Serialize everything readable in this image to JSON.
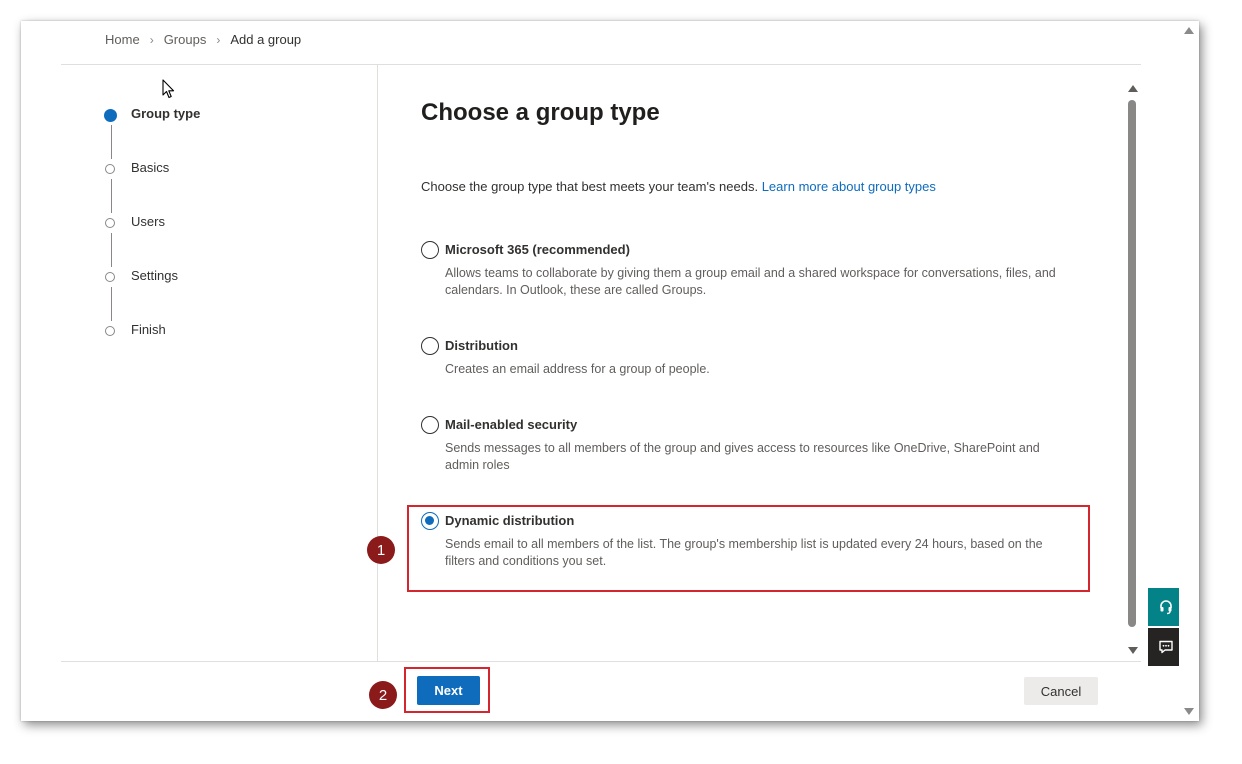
{
  "breadcrumb": {
    "items": [
      "Home",
      "Groups",
      "Add a group"
    ]
  },
  "steps": [
    {
      "label": "Group type",
      "active": true
    },
    {
      "label": "Basics",
      "active": false
    },
    {
      "label": "Users",
      "active": false
    },
    {
      "label": "Settings",
      "active": false
    },
    {
      "label": "Finish",
      "active": false
    }
  ],
  "main": {
    "title": "Choose a group type",
    "intro": "Choose the group type that best meets your team's needs.",
    "learn_more": "Learn more about group types",
    "options": [
      {
        "name": "Microsoft 365 (recommended)",
        "description": "Allows teams to collaborate by giving them a group email and a shared workspace for conversations, files, and calendars. In Outlook, these are called Groups.",
        "checked": false
      },
      {
        "name": "Distribution",
        "description": "Creates an email address for a group of people.",
        "checked": false
      },
      {
        "name": "Mail-enabled security",
        "description": "Sends messages to all members of the group and gives access to resources like OneDrive, SharePoint and admin roles",
        "checked": false
      },
      {
        "name": "Dynamic distribution",
        "description": "Sends email to all members of the list. The group's membership list is updated every 24 hours, based on the filters and conditions you set.",
        "checked": true
      }
    ]
  },
  "footer": {
    "next_label": "Next",
    "cancel_label": "Cancel"
  },
  "annotations": {
    "step1": "1",
    "step2": "2"
  },
  "icons": {
    "help": "headset-icon",
    "feedback": "feedback-icon",
    "cursor": "mouse-cursor-icon"
  },
  "colors": {
    "accent": "#0f6cbd",
    "highlight": "#d3262e",
    "badge": "#8b1a1a",
    "help_button": "#038387"
  }
}
